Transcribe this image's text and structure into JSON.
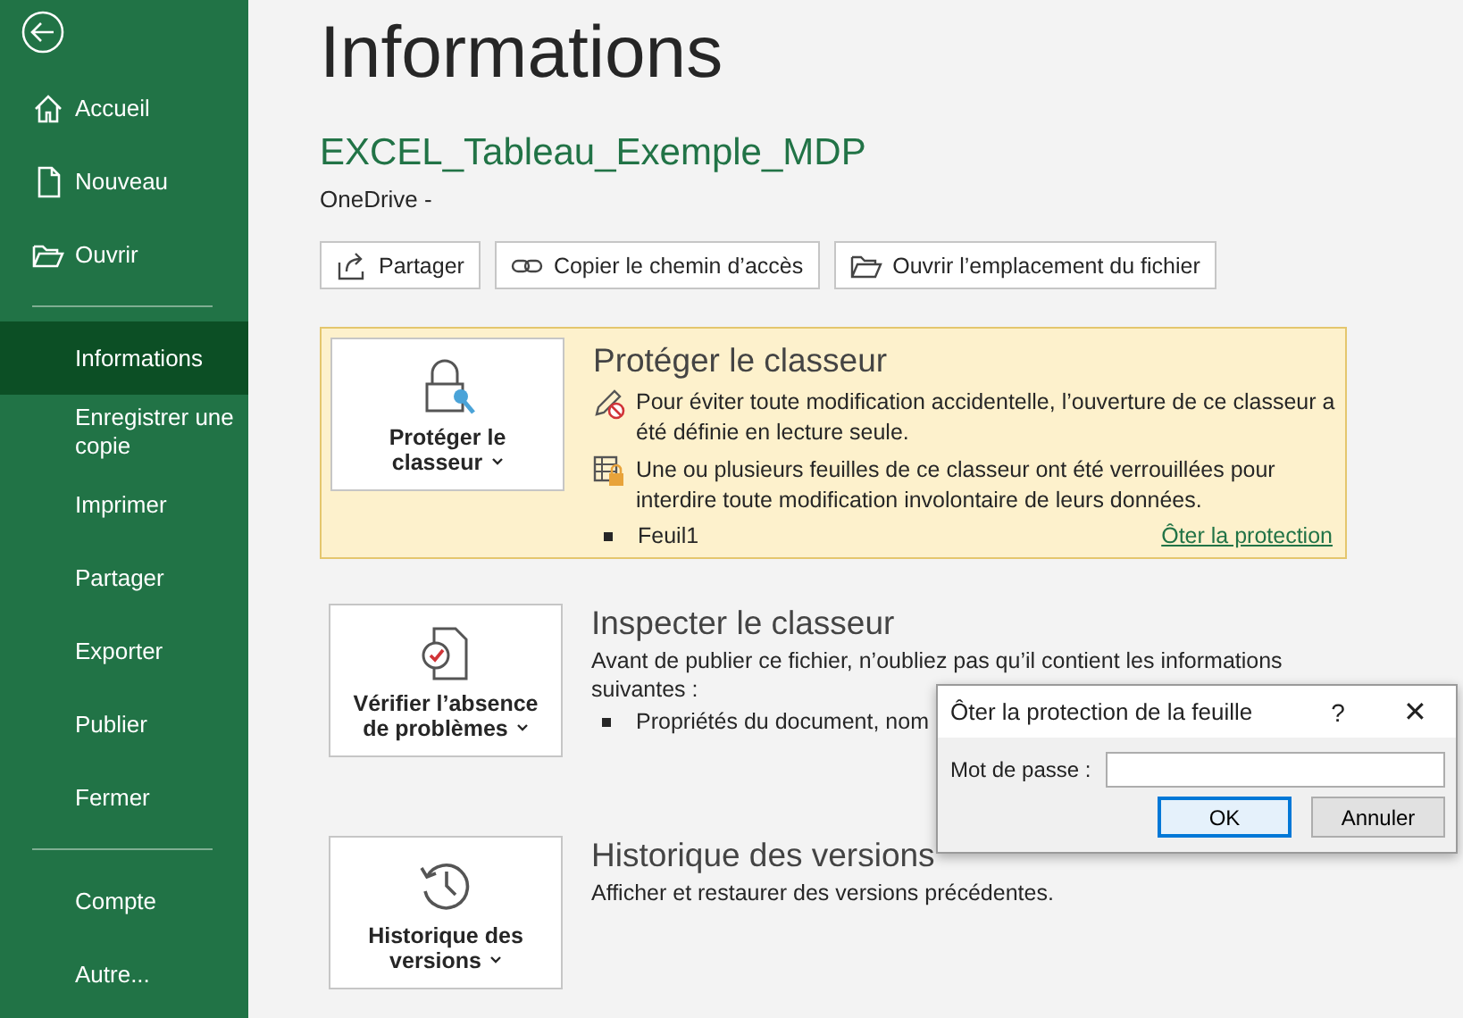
{
  "sidebar": {
    "groups": [
      [
        {
          "label": "Accueil",
          "selected": false
        },
        {
          "label": "Nouveau",
          "selected": false
        },
        {
          "label": "Ouvrir",
          "selected": false
        }
      ],
      [
        {
          "label": "Informations",
          "selected": true
        },
        {
          "label": "Enregistrer une copie",
          "selected": false
        },
        {
          "label": "Imprimer",
          "selected": false
        },
        {
          "label": "Partager",
          "selected": false
        },
        {
          "label": "Exporter",
          "selected": false
        },
        {
          "label": "Publier",
          "selected": false
        },
        {
          "label": "Fermer",
          "selected": false
        }
      ],
      [
        {
          "label": "Compte",
          "selected": false
        },
        {
          "label": "Autre...",
          "selected": false
        }
      ]
    ]
  },
  "page_title": "Informations",
  "file_name": "EXCEL_Tableau_Exemple_MDP",
  "location": "OneDrive -",
  "actions": [
    "Partager",
    "Copier le chemin d’accès",
    "Ouvrir l’emplacement du fichier"
  ],
  "sections": [
    {
      "kind": "protect",
      "button": "Protéger le classeur",
      "title": "Protéger le classeur",
      "notes": [
        "Pour éviter toute modification accidentelle, l’ouverture de ce classeur a été définie en lecture seule.",
        "Une ou plusieurs feuilles de ce classeur ont été verrouillées pour interdire toute modification involontaire de leurs données."
      ],
      "sheets": [
        "Feuil1"
      ],
      "link": "Ôter la protection"
    },
    {
      "kind": "inspect",
      "button": "Vérifier l’absence de problèmes",
      "title": "Inspecter le classeur",
      "lines": [
        "Avant de publier ce fichier, n’oubliez pas qu’il contient les informations",
        "suivantes :"
      ],
      "bullets": [
        "Propriétés du document, nom"
      ]
    },
    {
      "kind": "history",
      "button": "Historique des versions",
      "title": "Historique des versions",
      "text": "Afficher et restaurer des versions précédentes."
    }
  ],
  "dialog": {
    "title": "Ôter la protection de la feuille",
    "help": "?",
    "close": "✕",
    "field_label": "Mot de passe :",
    "buttons": [
      {
        "label": "OK",
        "selected": true
      },
      {
        "label": "Annuler",
        "selected": false
      }
    ]
  }
}
